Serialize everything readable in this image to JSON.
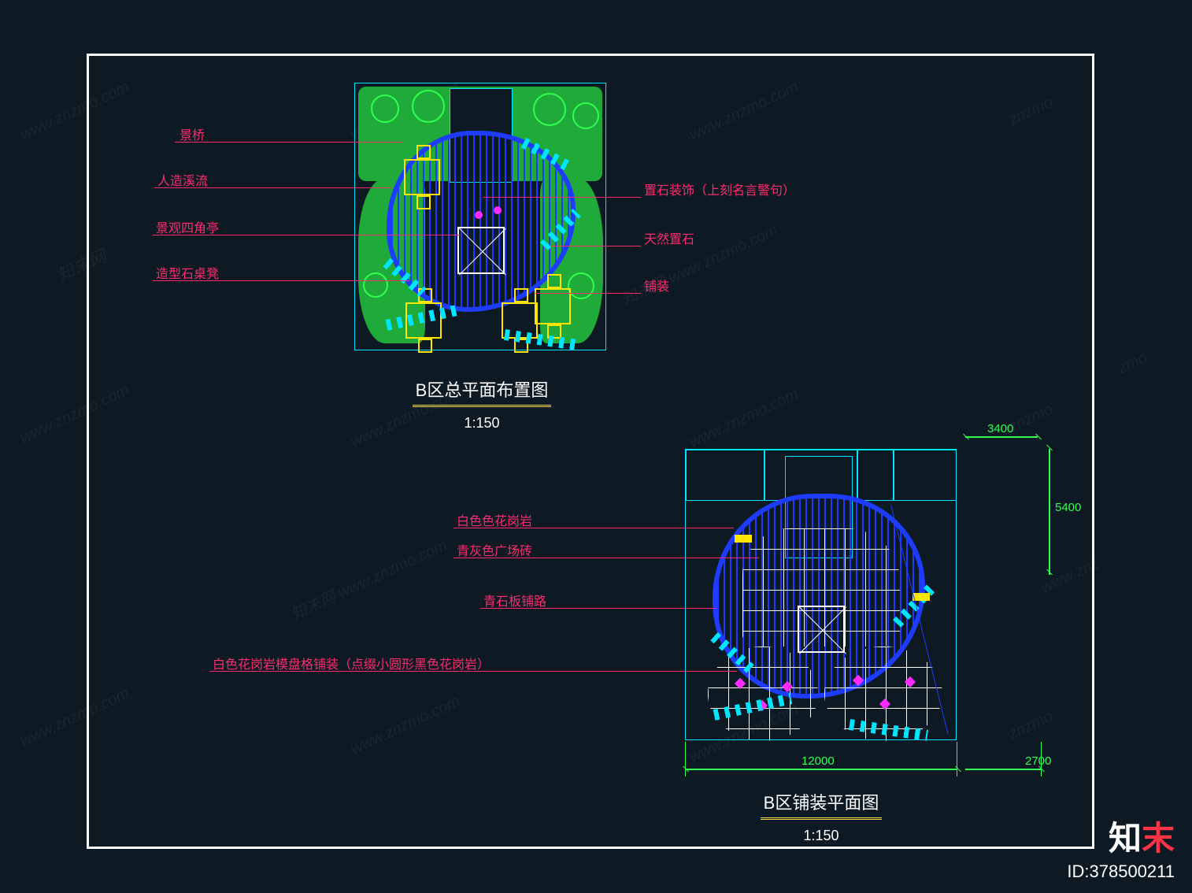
{
  "frame": {},
  "plan_a": {
    "title": "B区总平面布置图",
    "scale": "1:150",
    "callouts_left": [
      {
        "label": "景桥"
      },
      {
        "label": "人造溪流"
      },
      {
        "label": "景观四角亭"
      },
      {
        "label": "造型石桌凳"
      }
    ],
    "callouts_right": [
      {
        "label": "置石装饰（上刻名言警句）"
      },
      {
        "label": "天然置石"
      },
      {
        "label": "铺装"
      }
    ]
  },
  "plan_b": {
    "title": "B区铺装平面图",
    "scale": "1:150",
    "callouts_left": [
      {
        "label": "白色色花岗岩"
      },
      {
        "label": "青灰色广场砖"
      },
      {
        "label": "青石板铺路"
      },
      {
        "label": "白色花岗岩模盘格铺装（点缀小圆形黑色花岗岩）"
      }
    ],
    "dimensions": {
      "top_right": "3400",
      "right_vert": "5400",
      "bottom_main": "12000",
      "bottom_right": "2700"
    }
  },
  "watermarks": [
    "www.znzmo.com",
    "www.znzmo.com",
    "www.znzmo.com",
    "www.znzmo.com",
    "www.znzmo.com",
    "www.znzmo.com",
    "www.znzmo.com",
    "www.znzmo.com",
    "znzmo",
    "znzmo",
    "znzmo",
    "zmo",
    "www.znzmo.com",
    "www.znz",
    "知末网",
    "知末网 www.znzmo.com",
    "知末网 www.znzmo.com"
  ],
  "brand": {
    "logo_a": "知",
    "logo_b": "末",
    "id_label": "ID:378500211"
  },
  "colors": {
    "bg": "#0d1a24",
    "cyan": "#00e5ff",
    "blue": "#1e3cff",
    "green": "#2fff4e",
    "darkgreen": "#1faa3a",
    "yellow": "#ffe600",
    "gold": "#f5d94d",
    "magenta": "#ff2aff",
    "red": "#ff2a6d"
  }
}
